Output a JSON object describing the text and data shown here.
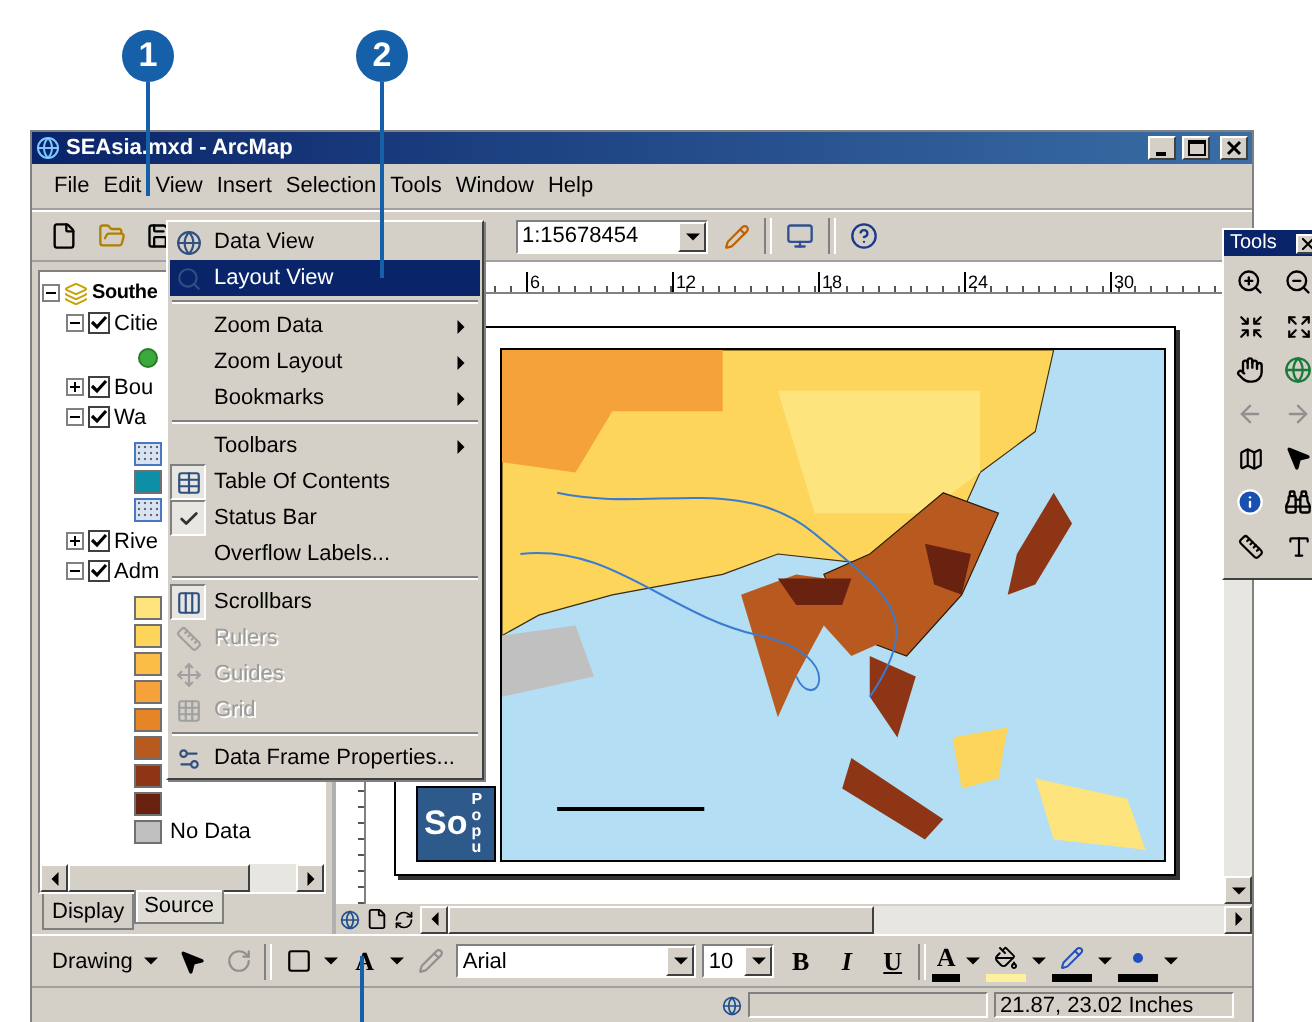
{
  "callouts": [
    {
      "label": "1"
    },
    {
      "label": "2"
    }
  ],
  "window": {
    "title": "SEAsia.mxd - ArcMap"
  },
  "menubar": [
    "File",
    "Edit",
    "View",
    "Insert",
    "Selection",
    "Tools",
    "Window",
    "Help"
  ],
  "toolbar": {
    "scale": "1:15678454"
  },
  "view_menu": {
    "groups": [
      [
        {
          "label": "Data View",
          "selected": false,
          "checked": false,
          "disabled": false,
          "submenu": false
        },
        {
          "label": "Layout View",
          "selected": true,
          "checked": false,
          "disabled": false,
          "submenu": false
        }
      ],
      [
        {
          "label": "Zoom Data",
          "selected": false,
          "checked": false,
          "disabled": false,
          "submenu": true
        },
        {
          "label": "Zoom Layout",
          "selected": false,
          "checked": false,
          "disabled": false,
          "submenu": true
        },
        {
          "label": "Bookmarks",
          "selected": false,
          "checked": false,
          "disabled": false,
          "submenu": true
        }
      ],
      [
        {
          "label": "Toolbars",
          "selected": false,
          "checked": false,
          "disabled": false,
          "submenu": true
        },
        {
          "label": "Table Of Contents",
          "selected": false,
          "checked": true,
          "disabled": false,
          "submenu": false
        },
        {
          "label": "Status Bar",
          "selected": false,
          "checked": true,
          "disabled": false,
          "submenu": false
        },
        {
          "label": "Overflow Labels...",
          "selected": false,
          "checked": false,
          "disabled": false,
          "submenu": false
        }
      ],
      [
        {
          "label": "Scrollbars",
          "selected": false,
          "checked": true,
          "disabled": false,
          "submenu": false
        },
        {
          "label": "Rulers",
          "selected": false,
          "checked": false,
          "disabled": true,
          "submenu": false
        },
        {
          "label": "Guides",
          "selected": false,
          "checked": false,
          "disabled": true,
          "submenu": false
        },
        {
          "label": "Grid",
          "selected": false,
          "checked": false,
          "disabled": true,
          "submenu": false
        }
      ],
      [
        {
          "label": "Data Frame Properties...",
          "selected": false,
          "checked": false,
          "disabled": false,
          "submenu": false
        }
      ]
    ]
  },
  "toc": {
    "tree": [
      {
        "name": "Southe",
        "expanded": true,
        "children": [
          {
            "name": "Citie",
            "checked": true,
            "expanded": true,
            "legend": [
              {
                "kind": "dot",
                "color": "#3aa83a"
              }
            ]
          },
          {
            "name": "Bou",
            "checked": true,
            "expanded": false
          },
          {
            "name": "Wa",
            "checked": true,
            "expanded": true,
            "legend": [
              {
                "kind": "pattern",
                "color": "#d8e4f4"
              },
              {
                "kind": "fill",
                "color": "#0e8fa8"
              },
              {
                "kind": "pattern",
                "color": "#d8e4f4"
              }
            ]
          },
          {
            "name": "Rive",
            "checked": true,
            "expanded": false
          },
          {
            "name": "Adm",
            "checked": true,
            "expanded": true,
            "legend": [
              {
                "kind": "fill",
                "color": "#fde47c"
              },
              {
                "kind": "fill",
                "color": "#fcd55a"
              },
              {
                "kind": "fill",
                "color": "#fbbd45"
              },
              {
                "kind": "fill",
                "color": "#f6a23a"
              },
              {
                "kind": "fill",
                "color": "#e58426"
              },
              {
                "kind": "fill",
                "color": "#b85a20"
              },
              {
                "kind": "fill",
                "color": "#8e3516"
              },
              {
                "kind": "fill",
                "color": "#6a2210"
              },
              {
                "kind": "fill",
                "color": "#c0c0c0",
                "label": "No Data"
              }
            ]
          }
        ]
      }
    ],
    "tabs": [
      {
        "label": "Display",
        "selected": true
      },
      {
        "label": "Source",
        "selected": false
      }
    ]
  },
  "ruler_ticks": [
    "6",
    "12",
    "18",
    "24",
    "30"
  ],
  "layout": {
    "title": "So",
    "subtitle": "Popu"
  },
  "drawing_toolbar": {
    "label": "Drawing",
    "text_tool": "A",
    "font": "Arial",
    "size": "10",
    "styles": [
      "B",
      "I",
      "U"
    ],
    "font_color": "A"
  },
  "tools_palette": {
    "title": "Tools"
  },
  "status_bar": {
    "coordinates": "21.87, 23.02 Inches"
  }
}
